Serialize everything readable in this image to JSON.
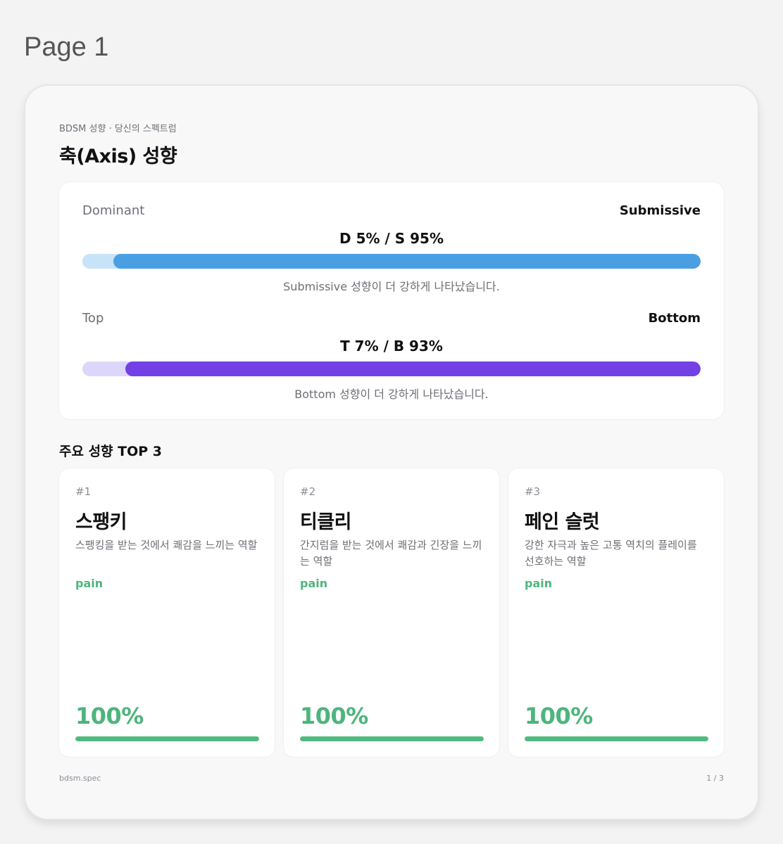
{
  "page_label": "Page 1",
  "header": {
    "eyebrow": "BDSM 성향 · 당신의 스펙트럼",
    "title": "축(Axis) 성향"
  },
  "axes": [
    {
      "left_label": "Dominant",
      "right_label": "Submissive",
      "value_text": "D 5% / S 95%",
      "left_percent": 5,
      "right_percent": 95,
      "note": "Submissive 성향이 더 강하게 나타났습니다.",
      "track_color": "#c7e3f8",
      "fill_color": "#4a9fe3"
    },
    {
      "left_label": "Top",
      "right_label": "Bottom",
      "value_text": "T 7% / B 93%",
      "left_percent": 7,
      "right_percent": 93,
      "note": "Bottom 성향이 더 강하게 나타났습니다.",
      "track_color": "#ddd6fb",
      "fill_color": "#7340e6"
    }
  ],
  "top3": {
    "title": "주요 성향 TOP 3",
    "cards": [
      {
        "rank": "#1",
        "name": "스팽키",
        "desc": "스팽킹을 받는 것에서 쾌감을 느끼는 역할",
        "tag": "pain",
        "score_text": "100%",
        "score_percent": 100
      },
      {
        "rank": "#2",
        "name": "티클리",
        "desc": "간지럼을 받는 것에서 쾌감과 긴장을 느끼는 역할",
        "tag": "pain",
        "score_text": "100%",
        "score_percent": 100
      },
      {
        "rank": "#3",
        "name": "페인 슬럿",
        "desc": "강한 자극과 높은 고통 역치의 플레이를 선호하는 역할",
        "tag": "pain",
        "score_text": "100%",
        "score_percent": 100
      }
    ]
  },
  "footer": {
    "brand": "bdsm.spec",
    "page_indicator": "1 / 3"
  }
}
